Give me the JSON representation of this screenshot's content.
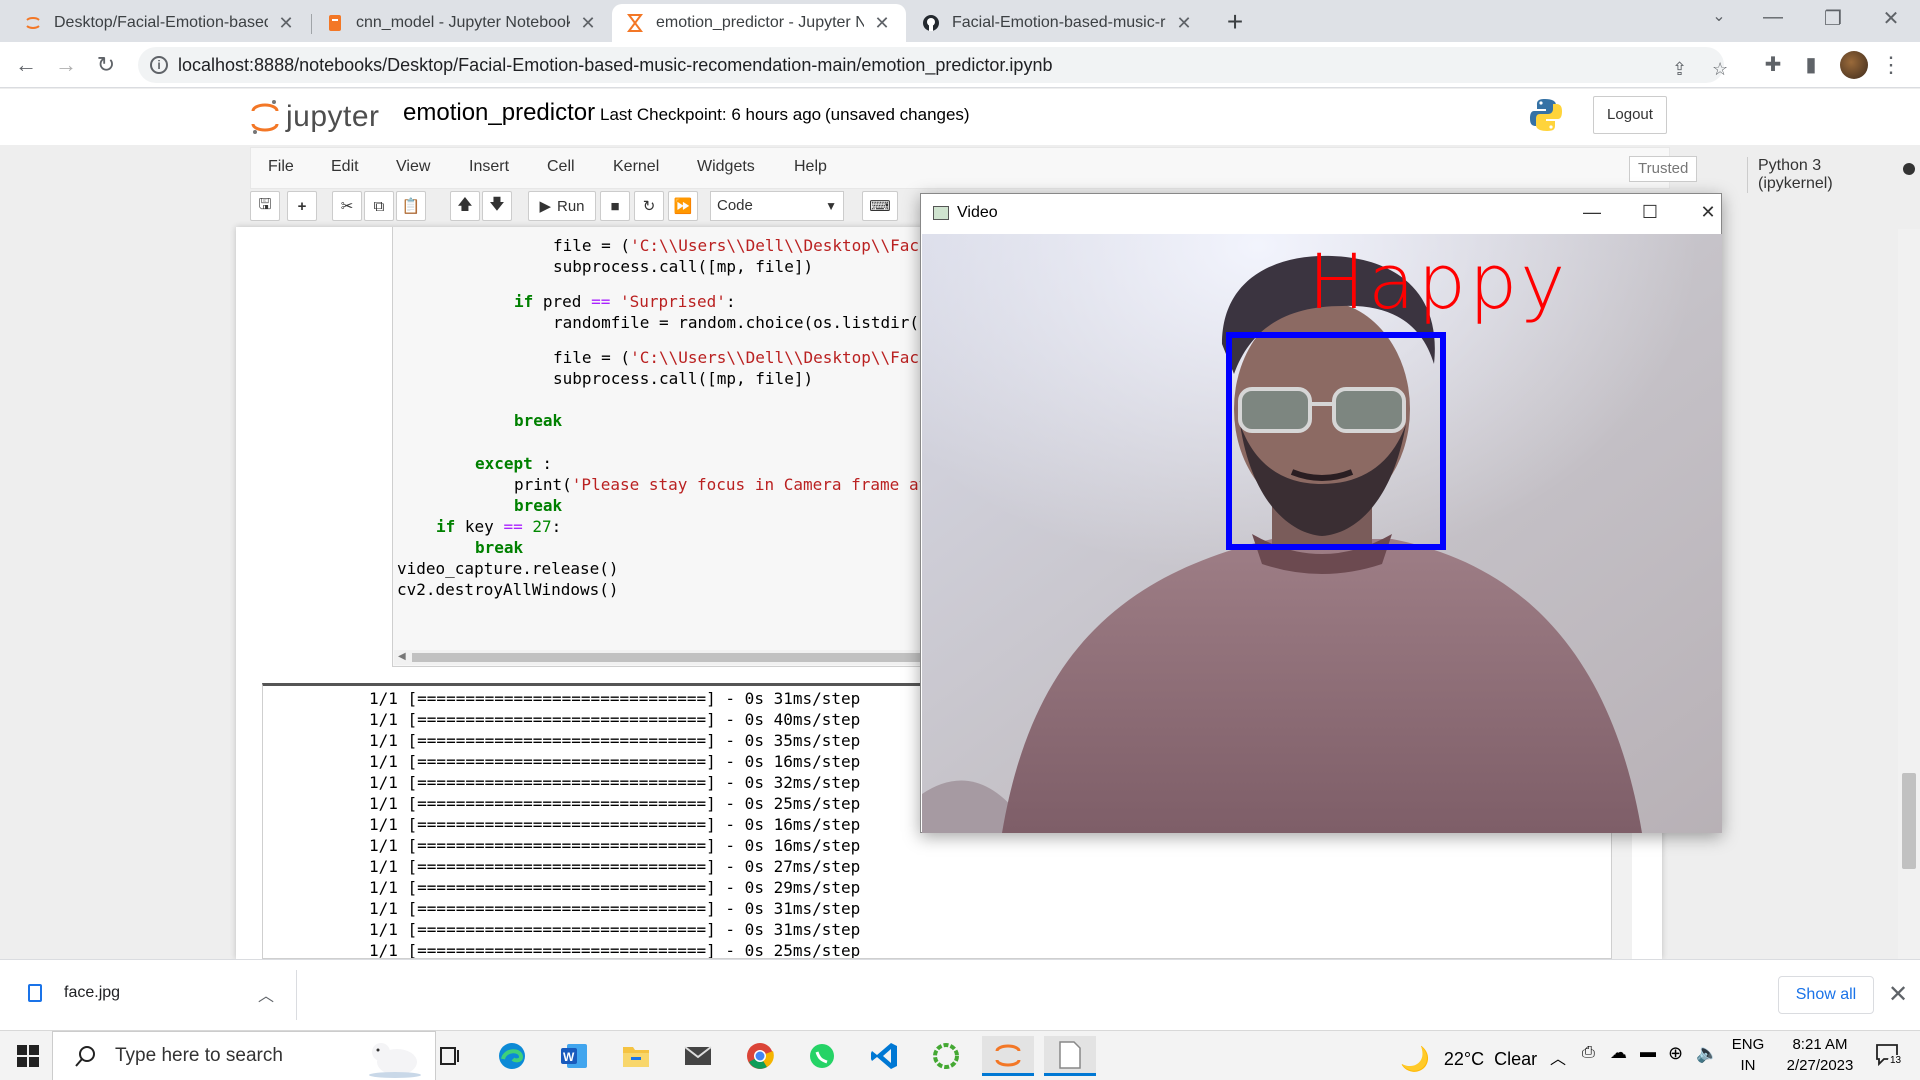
{
  "browser": {
    "tabs": [
      {
        "title": "Desktop/Facial-Emotion-based-n",
        "icon": "jupyter-icon",
        "active": false
      },
      {
        "title": "cnn_model - Jupyter Notebook",
        "icon": "notebook-icon",
        "active": false
      },
      {
        "title": "emotion_predictor - Jupyter Note",
        "icon": "hourglass-icon",
        "active": true
      },
      {
        "title": "Facial-Emotion-based-music-rec",
        "icon": "github-icon",
        "active": false
      }
    ],
    "tab_close": "✕",
    "new_tab": "+",
    "url": "localhost:8888/notebooks/Desktop/Facial-Emotion-based-music-recomendation-main/emotion_predictor.ipynb"
  },
  "jupyter": {
    "logo_text": "jupyter",
    "notebook_name": "emotion_predictor",
    "checkpoint": "Last Checkpoint: 6 hours ago",
    "unsaved": "(unsaved changes)",
    "logout": "Logout",
    "menu": [
      "File",
      "Edit",
      "View",
      "Insert",
      "Cell",
      "Kernel",
      "Widgets",
      "Help"
    ],
    "trusted": "Trusted",
    "kernel": "Python 3 (ipykernel)",
    "run_label": "Run",
    "cell_type": "Code"
  },
  "code": {
    "l1_pre": "file = (",
    "l1_str": "'C:\\\\Users\\\\Dell\\\\Desktop\\\\Faci",
    "l2": "subprocess.call([mp, file])",
    "l3_kw": "if",
    "l3_mid": " pred ",
    "l3_op": "==",
    "l3_str": "'Surprised'",
    "l3_end": ":",
    "l4": "randomfile = random.choice(os.listdir('",
    "l5_pre": "file = (",
    "l5_str": "'C:\\\\Users\\\\Dell\\\\Desktop\\\\Faci",
    "l6": "subprocess.call([mp, file])",
    "l7_kw": "break",
    "l8_kw": "except",
    "l8_end": " :",
    "l9_pre": "print(",
    "l9_str": "'Please stay focus in Camera frame at",
    "l10_kw": "break",
    "l11_kw": "if",
    "l11_mid": " key ",
    "l11_op": "==",
    "l11_num": "27",
    "l11_end": ":",
    "l12_kw": "break",
    "l13": "video_capture.release()",
    "l14": "cv2.destroyAllWindows()"
  },
  "output_lines": [
    "1/1 [==============================] - 0s 31ms/step",
    "1/1 [==============================] - 0s 40ms/step",
    "1/1 [==============================] - 0s 35ms/step",
    "1/1 [==============================] - 0s 16ms/step",
    "1/1 [==============================] - 0s 32ms/step",
    "1/1 [==============================] - 0s 25ms/step",
    "1/1 [==============================] - 0s 16ms/step",
    "1/1 [==============================] - 0s 16ms/step",
    "1/1 [==============================] - 0s 27ms/step",
    "1/1 [==============================] - 0s 29ms/step",
    "1/1 [==============================] - 0s 31ms/step",
    "1/1 [==============================] - 0s 31ms/step",
    "1/1 [==============================] - 0s 25ms/step"
  ],
  "video": {
    "window_title": "Video",
    "emotion_label": "Happy",
    "label_color": "#ff0000",
    "box_color": "#0000ff"
  },
  "downloads": {
    "file": "face.jpg",
    "show_all": "Show all"
  },
  "taskbar": {
    "search_placeholder": "Type here to search",
    "weather": "22°C  Clear",
    "lang_top": "ENG",
    "lang_bottom": "IN",
    "time": "8:21 AM",
    "date": "2/27/2023",
    "notifications": "13"
  }
}
